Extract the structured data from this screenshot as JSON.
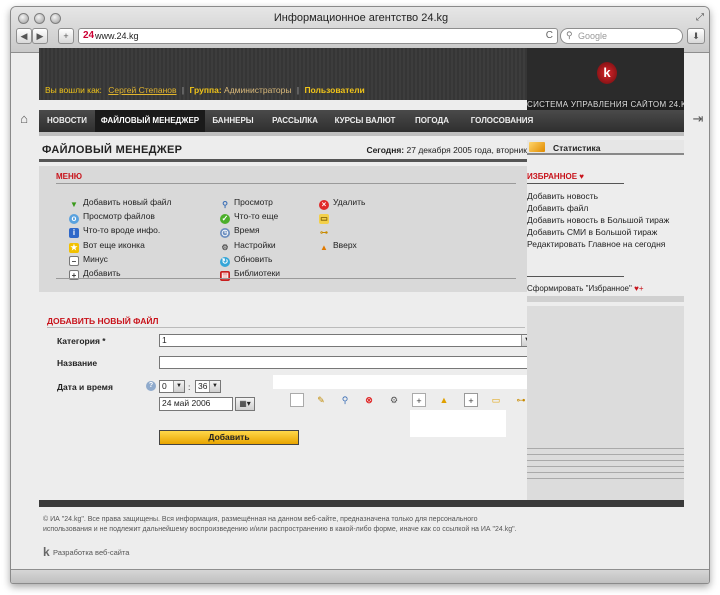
{
  "browser": {
    "title": "Информационное агентство 24.kg",
    "url": "www.24.kg",
    "search_placeholder": "Google",
    "back": "◀",
    "forward": "▶",
    "add": "+",
    "reload": "C",
    "download": "⬇"
  },
  "header": {
    "logged_as_label": "Вы вошли как:",
    "user_name": "Сергей Степанов",
    "group_label": "Группа:",
    "group_name": "Администраторы",
    "users_link": "Пользователи",
    "cms_title": "СИСТЕМА УПРАВЛЕНИЯ САЙТОМ 24.KG",
    "logo_letter": "k"
  },
  "nav": {
    "items": [
      {
        "label": "НОВОСТИ"
      },
      {
        "label": "ФАЙЛОВЫЙ МЕНЕДЖЕР",
        "active": true
      },
      {
        "label": "БАННЕРЫ"
      },
      {
        "label": "РАССЫЛКА"
      },
      {
        "label": "КУРСЫ ВАЛЮТ"
      },
      {
        "label": "ПОГОДА"
      },
      {
        "label": "ГОЛОСОВАНИЯ"
      }
    ]
  },
  "page": {
    "title": "ФАЙЛОВЫЙ МЕНЕДЖЕР",
    "today_label": "Сегодня:",
    "today_value": "27 декабря 2005 года, вторник"
  },
  "menu": {
    "heading": "МЕНЮ",
    "col1": [
      {
        "label": "Добавить новый файл",
        "icon": "green-arrow-icon"
      },
      {
        "label": "Просмотр файлов",
        "icon": "globe-icon"
      },
      {
        "label": "Что-то вроде инфо.",
        "icon": "info-icon"
      },
      {
        "label": "Вот еще иконка",
        "icon": "star-icon"
      },
      {
        "label": "Минус",
        "icon": "minus-icon"
      },
      {
        "label": "Добавить",
        "icon": "plus-icon"
      }
    ],
    "col2": [
      {
        "label": "Просмотр",
        "icon": "magnifier-icon"
      },
      {
        "label": "Что-то еще",
        "icon": "check-icon"
      },
      {
        "label": "Время",
        "icon": "clock-icon"
      },
      {
        "label": "Настройки",
        "icon": "gear-icon"
      },
      {
        "label": "Обновить",
        "icon": "refresh-icon"
      },
      {
        "label": "Библиотеки",
        "icon": "books-icon"
      }
    ],
    "col3": [
      {
        "label": "Удалить",
        "icon": "delete-icon"
      },
      {
        "label": "",
        "icon": "folder-icon"
      },
      {
        "label": "",
        "icon": "tree-icon"
      },
      {
        "label": "Вверх",
        "icon": "up-arrow-icon"
      }
    ]
  },
  "form": {
    "heading": "ДОБАВИТЬ НОВЫЙ ФАЙЛ",
    "category_label": "Категория *",
    "category_value": "1",
    "name_label": "Название",
    "name_value": "",
    "datetime_label": "Дата и время",
    "hour_value": "0",
    "time_sep": ":",
    "minute_value": "36",
    "date_value": "24 май 2006",
    "submit_label": "Добавить",
    "help": "?"
  },
  "toolbar_icons": [
    "document-icon",
    "edit-icon",
    "magnifier-icon",
    "delete-icon",
    "gear-icon",
    "add-file-icon",
    "folder-up-icon",
    "plus-icon",
    "add-folder-icon",
    "tree-icon"
  ],
  "sidebar": {
    "stats_label": "Статистика",
    "fav_heading": "ИЗБРАННОЕ",
    "fav_heart": "♥",
    "links": [
      {
        "label": "Добавить новость"
      },
      {
        "label": "Добавить файл"
      },
      {
        "label": "Добавить новость в Большой тираж"
      },
      {
        "label": "Добавить СМИ в Большой тираж"
      },
      {
        "label": "Редактировать Главное на сегодня"
      }
    ],
    "make_fav": "Сформировать \"Избранное\"",
    "make_fav_icon": "♥+"
  },
  "footer": {
    "copyright": "© ИА \"24.kg\". Все права защищены. Вся информация, размещённая на данном веб-сайте, предназначена только для персонального использования и не подлежит дальнейшему воспроизведению и/или распространению в какой-либо форме, иначе как со ссылкой на ИА \"24.kg\".",
    "dev_logo": "k",
    "dev_label": "Разработка веб-сайта"
  },
  "colors": {
    "accent_red": "#c8131b",
    "nav_bg": "#3a3a3a",
    "submit_yellow": "#f5c01e",
    "user_yellow": "#f0c419"
  }
}
